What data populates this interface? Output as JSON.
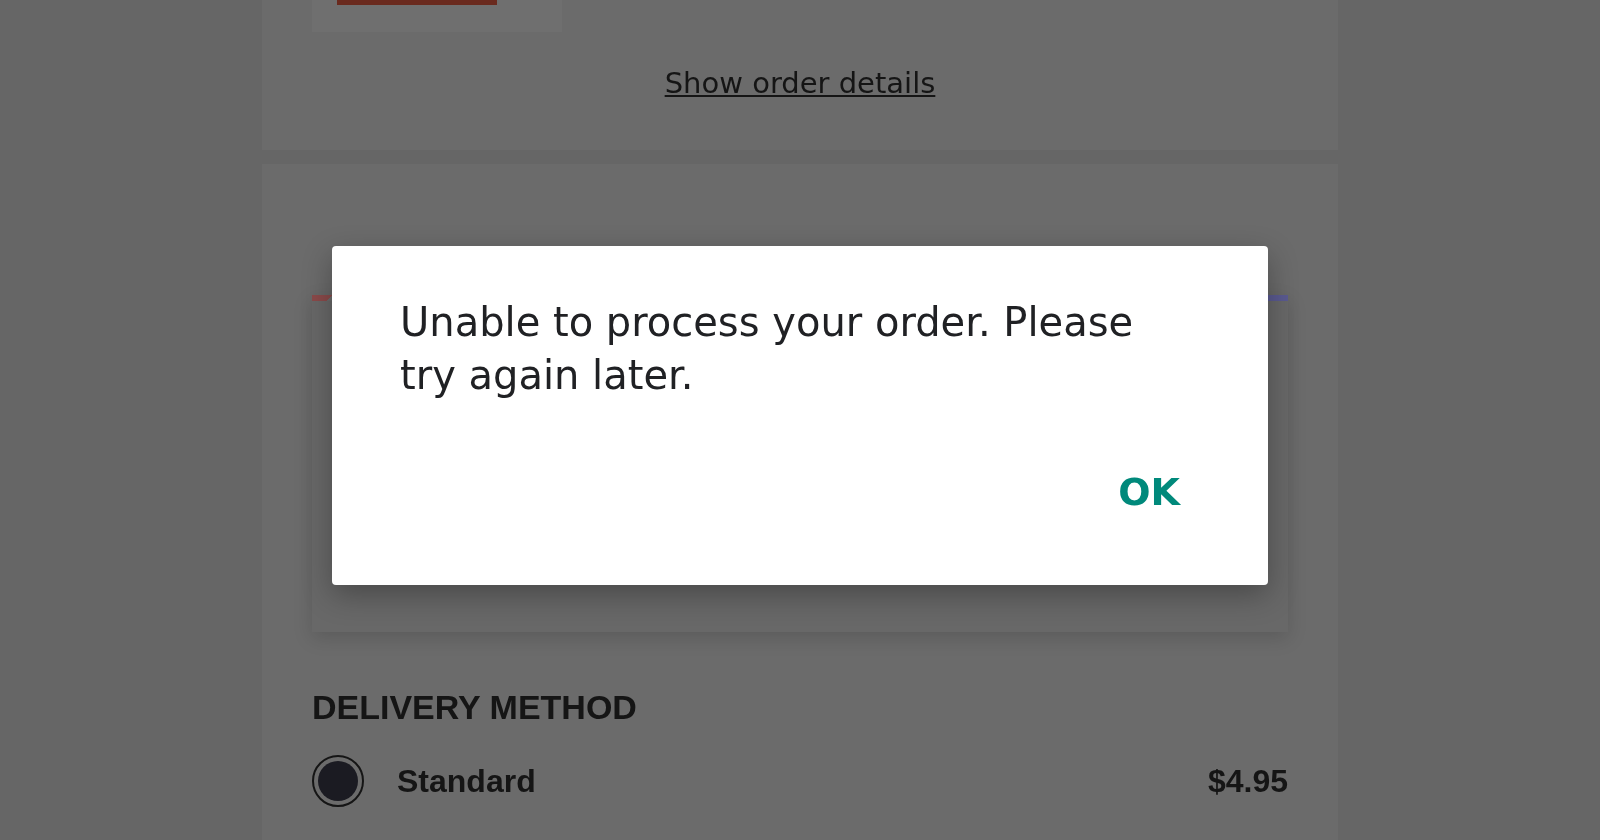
{
  "order_summary": {
    "link": "Show order details"
  },
  "delivery_method": {
    "heading": "DELIVERY METHOD",
    "options": [
      {
        "label": "Standard",
        "price": "$4.95",
        "selected": true
      }
    ]
  },
  "dialog": {
    "message": "Unable to process your order. Please try again later.",
    "buttons": [
      {
        "label": "OK"
      }
    ]
  }
}
